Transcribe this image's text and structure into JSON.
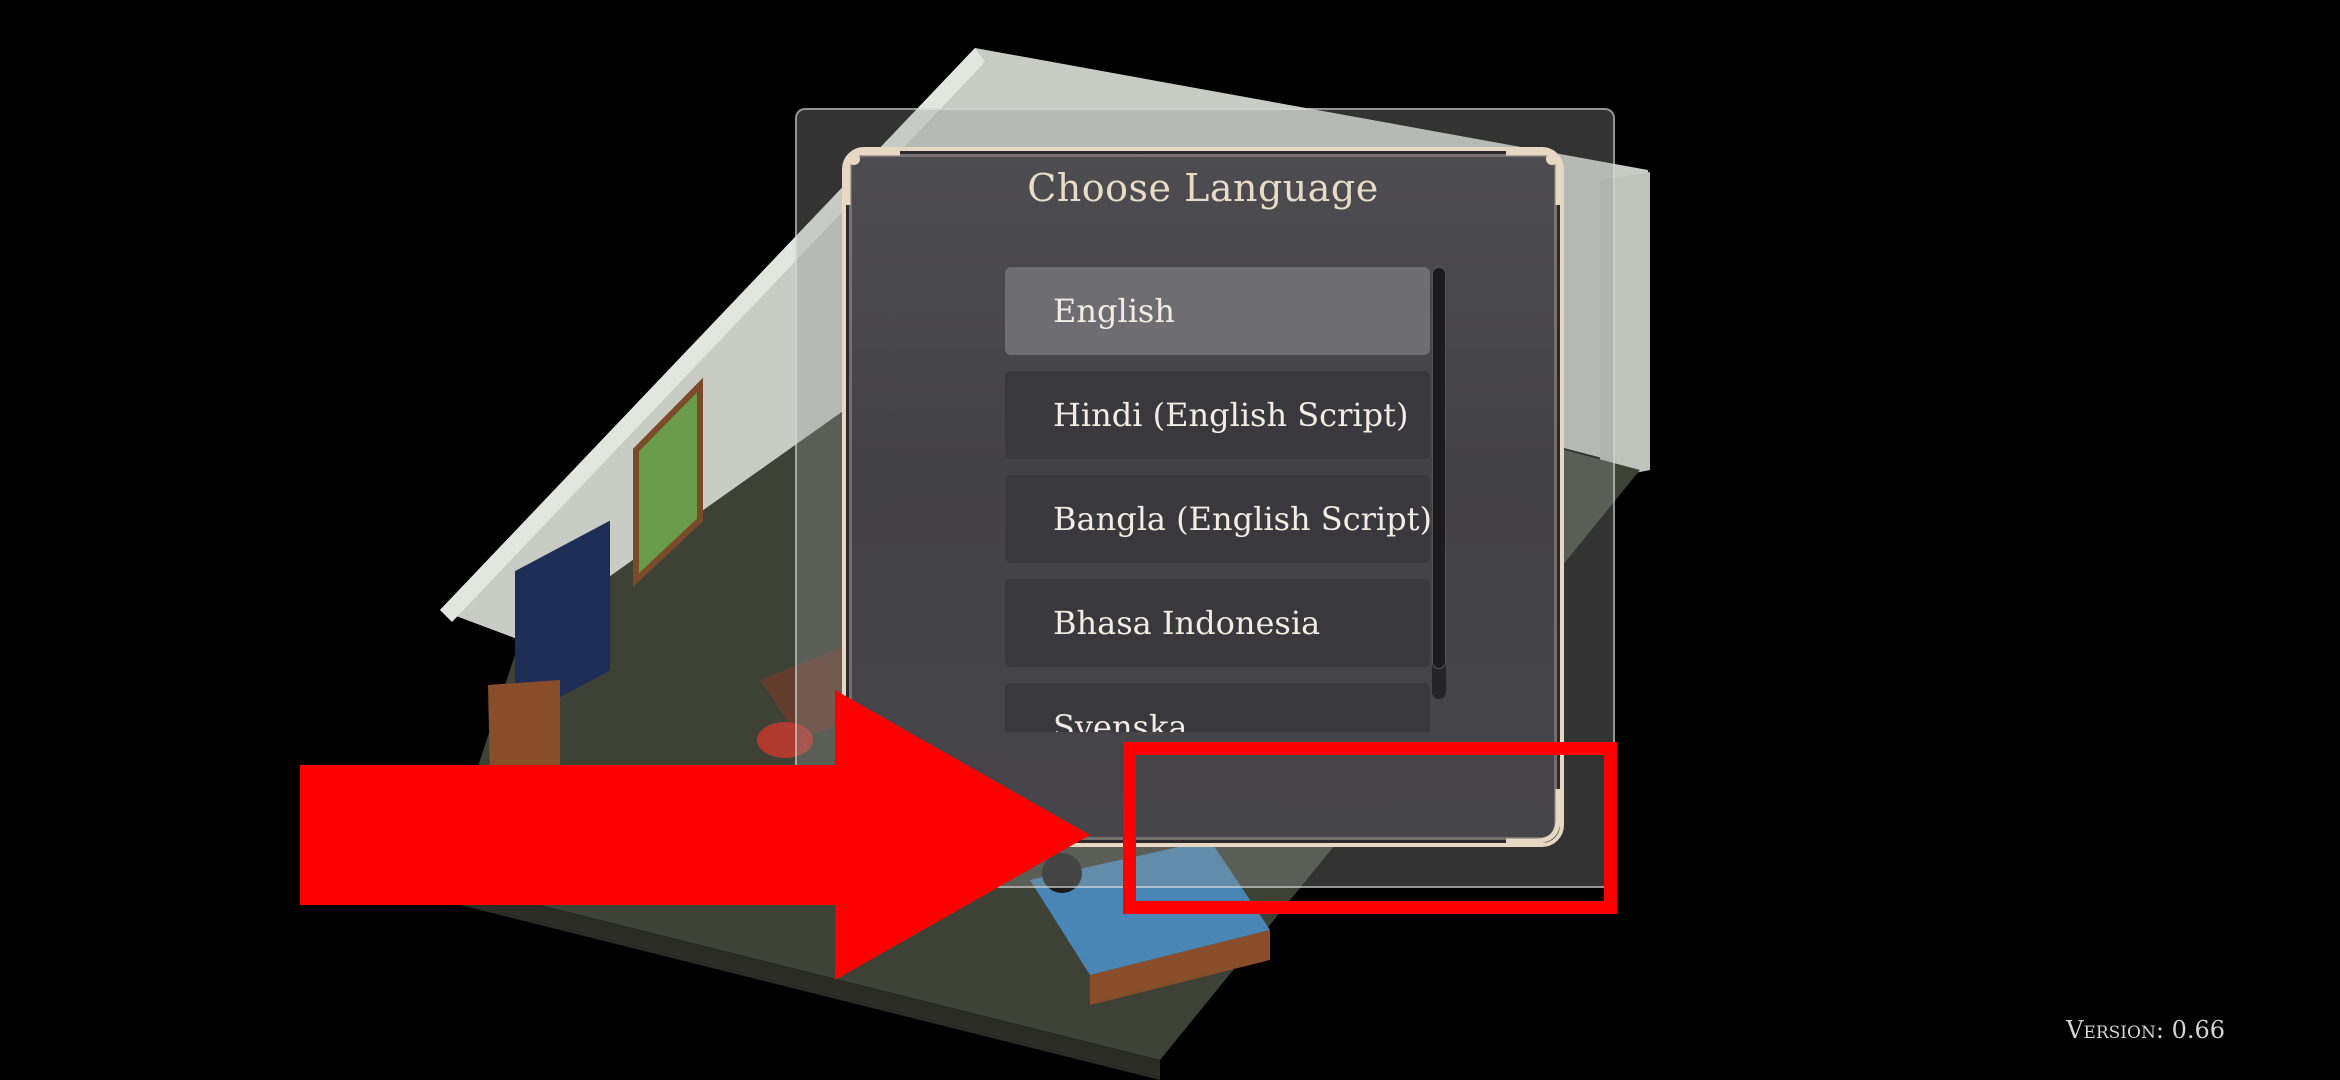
{
  "dialog": {
    "title": "Choose Language",
    "languages": [
      {
        "label": "English",
        "selected": true
      },
      {
        "label": "Hindi (English Script)",
        "selected": false
      },
      {
        "label": "Bangla (English Script)",
        "selected": false
      },
      {
        "label": "Bhasa Indonesia",
        "selected": false
      },
      {
        "label": "Svenska",
        "selected": false
      }
    ]
  },
  "footer": {
    "version_label": "Version:",
    "version_value": "0.66"
  },
  "icons": {
    "arrow": "arrow-right-icon",
    "highlight": "highlight-box"
  },
  "colors": {
    "background": "#000000",
    "dialog_fill": "#47464a",
    "dialog_border": "#e6d8c2",
    "selected_item": "#6e6d72",
    "item": "#39383c",
    "highlight": "#ff0000"
  }
}
